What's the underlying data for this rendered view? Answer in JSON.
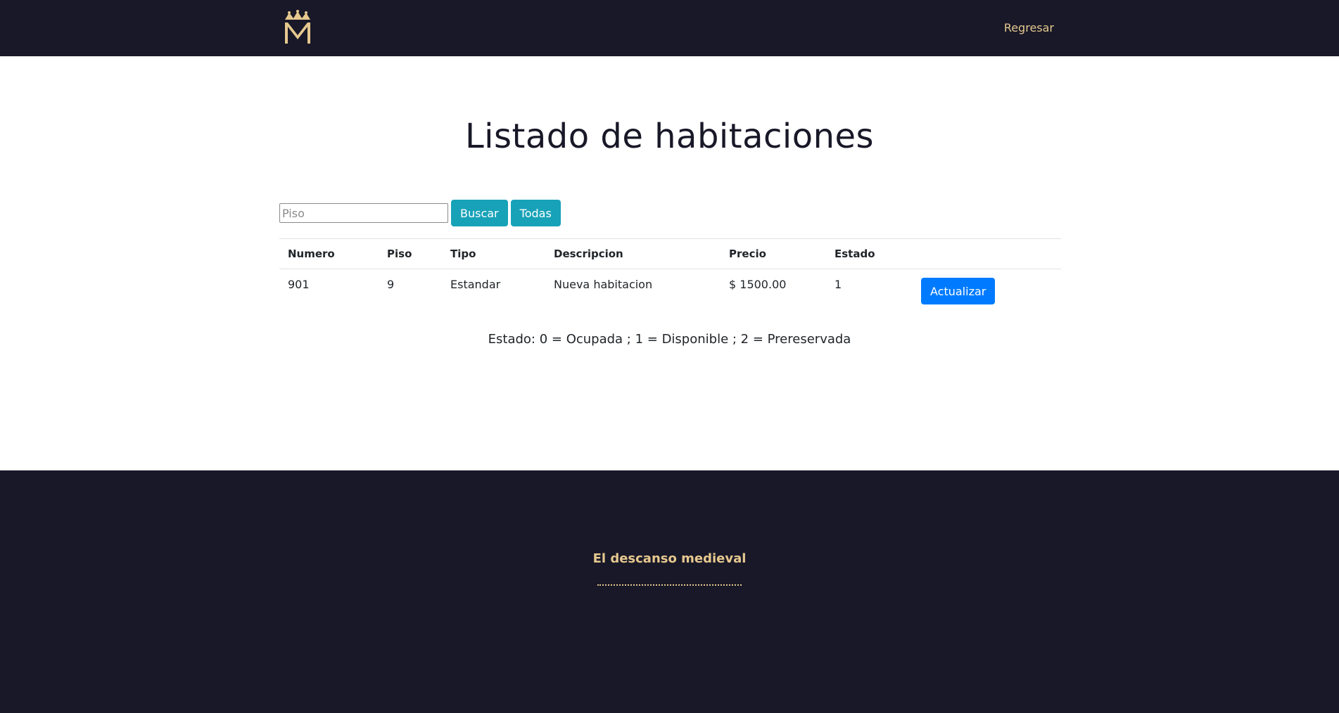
{
  "header": {
    "logo_alt": "M",
    "nav_link": "Regresar"
  },
  "main": {
    "title": "Listado de habitaciones",
    "search": {
      "placeholder": "Piso",
      "value": "",
      "search_button": "Buscar",
      "all_button": "Todas"
    },
    "table": {
      "columns": [
        "Numero",
        "Piso",
        "Tipo",
        "Descripcion",
        "Precio",
        "Estado",
        ""
      ],
      "rows": [
        {
          "numero": "901",
          "piso": "9",
          "tipo": "Estandar",
          "descripcion": "Nueva habitacion",
          "precio": "$ 1500.00",
          "estado": "1",
          "action": "Actualizar"
        }
      ]
    },
    "legend": "Estado: 0 = Ocupada ; 1 = Disponible ; 2 = Prereservada"
  },
  "footer": {
    "title": "El descanso medieval"
  },
  "colors": {
    "navbar_bg": "#181828",
    "gold_accent": "#e6c88f",
    "info_button": "#17a2b8",
    "primary_button": "#007bff"
  }
}
